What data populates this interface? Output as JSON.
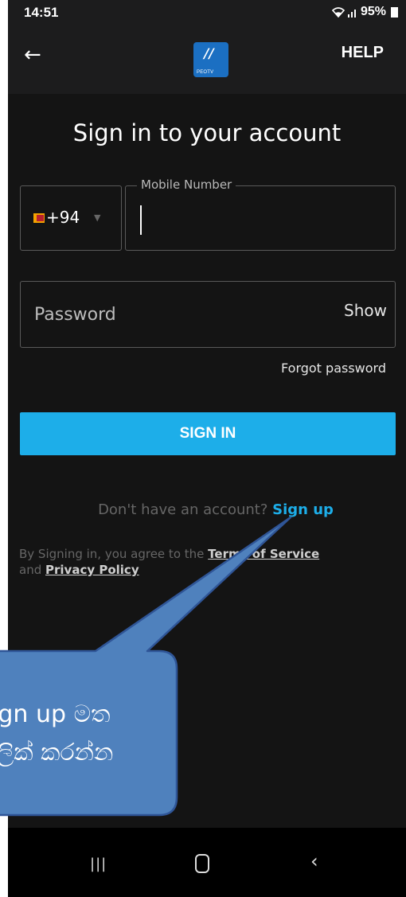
{
  "status_bar": {
    "time": "14:51",
    "battery": "95%"
  },
  "app_bar": {
    "logo_text": "PEOTV",
    "help_label": "HELP"
  },
  "form": {
    "title": "Sign in to your account",
    "country_code": "+94",
    "mobile_label": "Mobile Number",
    "mobile_value": "",
    "password_placeholder": "Password",
    "show_label": "Show",
    "forgot_label": "Forgot password",
    "signin_label": "SIGN IN",
    "no_account_text": "Don't have an account?",
    "signup_label": "Sign up",
    "terms_prefix": "By Signing in, you agree to the",
    "terms_link": "Terms of Service",
    "terms_and": "and",
    "privacy_link": "Privacy Policy"
  },
  "callout": {
    "line1": "Sign up මත",
    "line2": "ක්ලික් කරන්න"
  },
  "colors": {
    "accent": "#1daee9",
    "background": "#141414",
    "callout_fill": "#4f81bd",
    "callout_border": "#2f5597"
  },
  "icons": [
    "back-arrow-icon",
    "wifi-icon",
    "signal-icon",
    "battery-icon",
    "sri-lanka-flag-icon",
    "chevron-down-icon",
    "recent-apps-icon",
    "home-icon",
    "nav-back-icon"
  ]
}
